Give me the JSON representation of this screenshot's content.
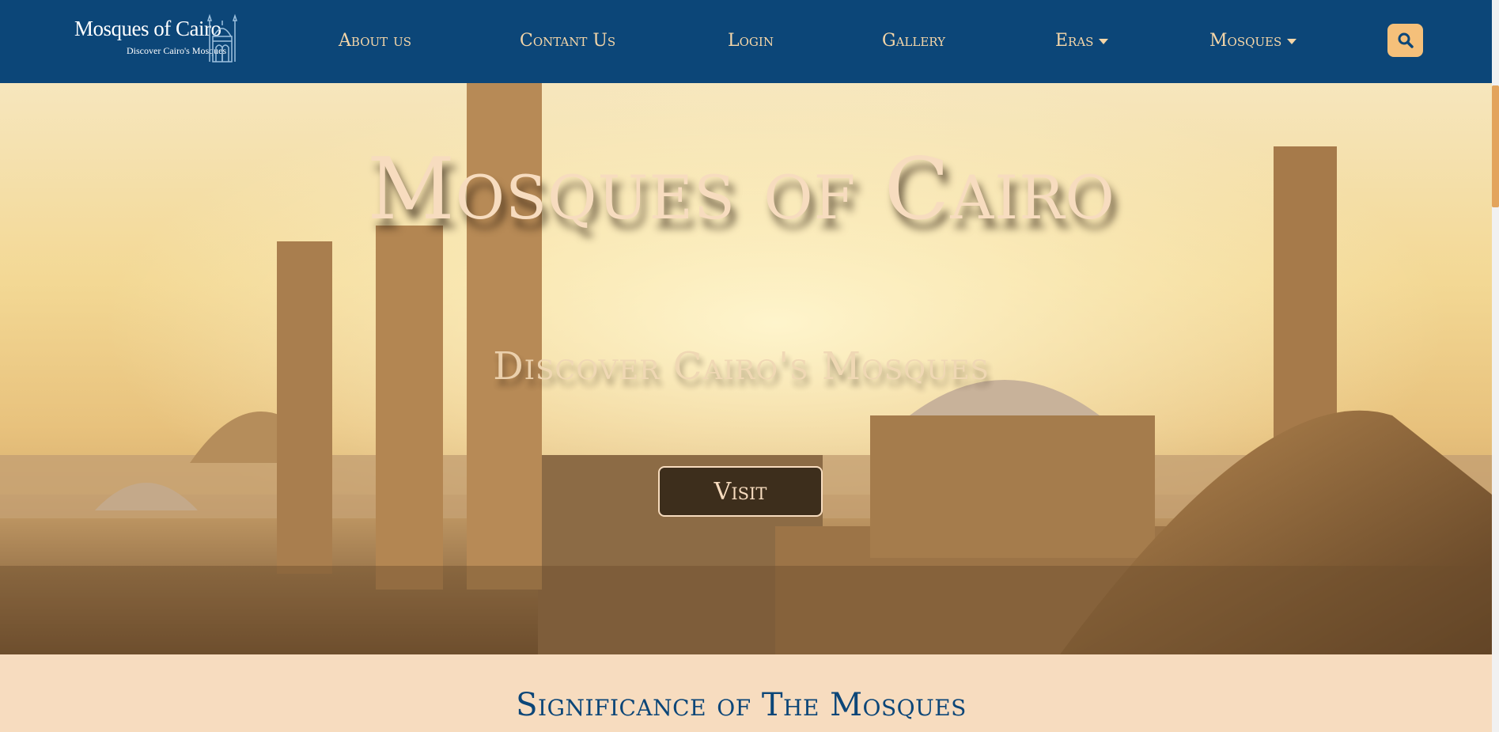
{
  "brand": {
    "title": "Mosques of Cairo",
    "tagline": "Discover Cairo's Mosques",
    "icon": "mosque-emblem-icon"
  },
  "nav": {
    "items": [
      {
        "label": "About us",
        "has_dropdown": false
      },
      {
        "label": "Contant Us",
        "has_dropdown": false
      },
      {
        "label": "Login",
        "has_dropdown": false
      },
      {
        "label": "Gallery",
        "has_dropdown": false
      },
      {
        "label": "Eras",
        "has_dropdown": true
      },
      {
        "label": "Mosques",
        "has_dropdown": true
      }
    ],
    "search_icon": "search-icon"
  },
  "hero": {
    "title": "Mosques of Cairo",
    "subtitle": "Discover Cairo's Mosques",
    "button_label": "Visit",
    "background": "cairo-skyline-minarets-sunset"
  },
  "section": {
    "title": "Significance of The Mosques"
  },
  "colors": {
    "navbar": "#0c4678",
    "nav_text": "#f5d6a8",
    "accent": "#f5c07a",
    "cream": "#f7dcbf",
    "section_title": "#0c4678"
  }
}
